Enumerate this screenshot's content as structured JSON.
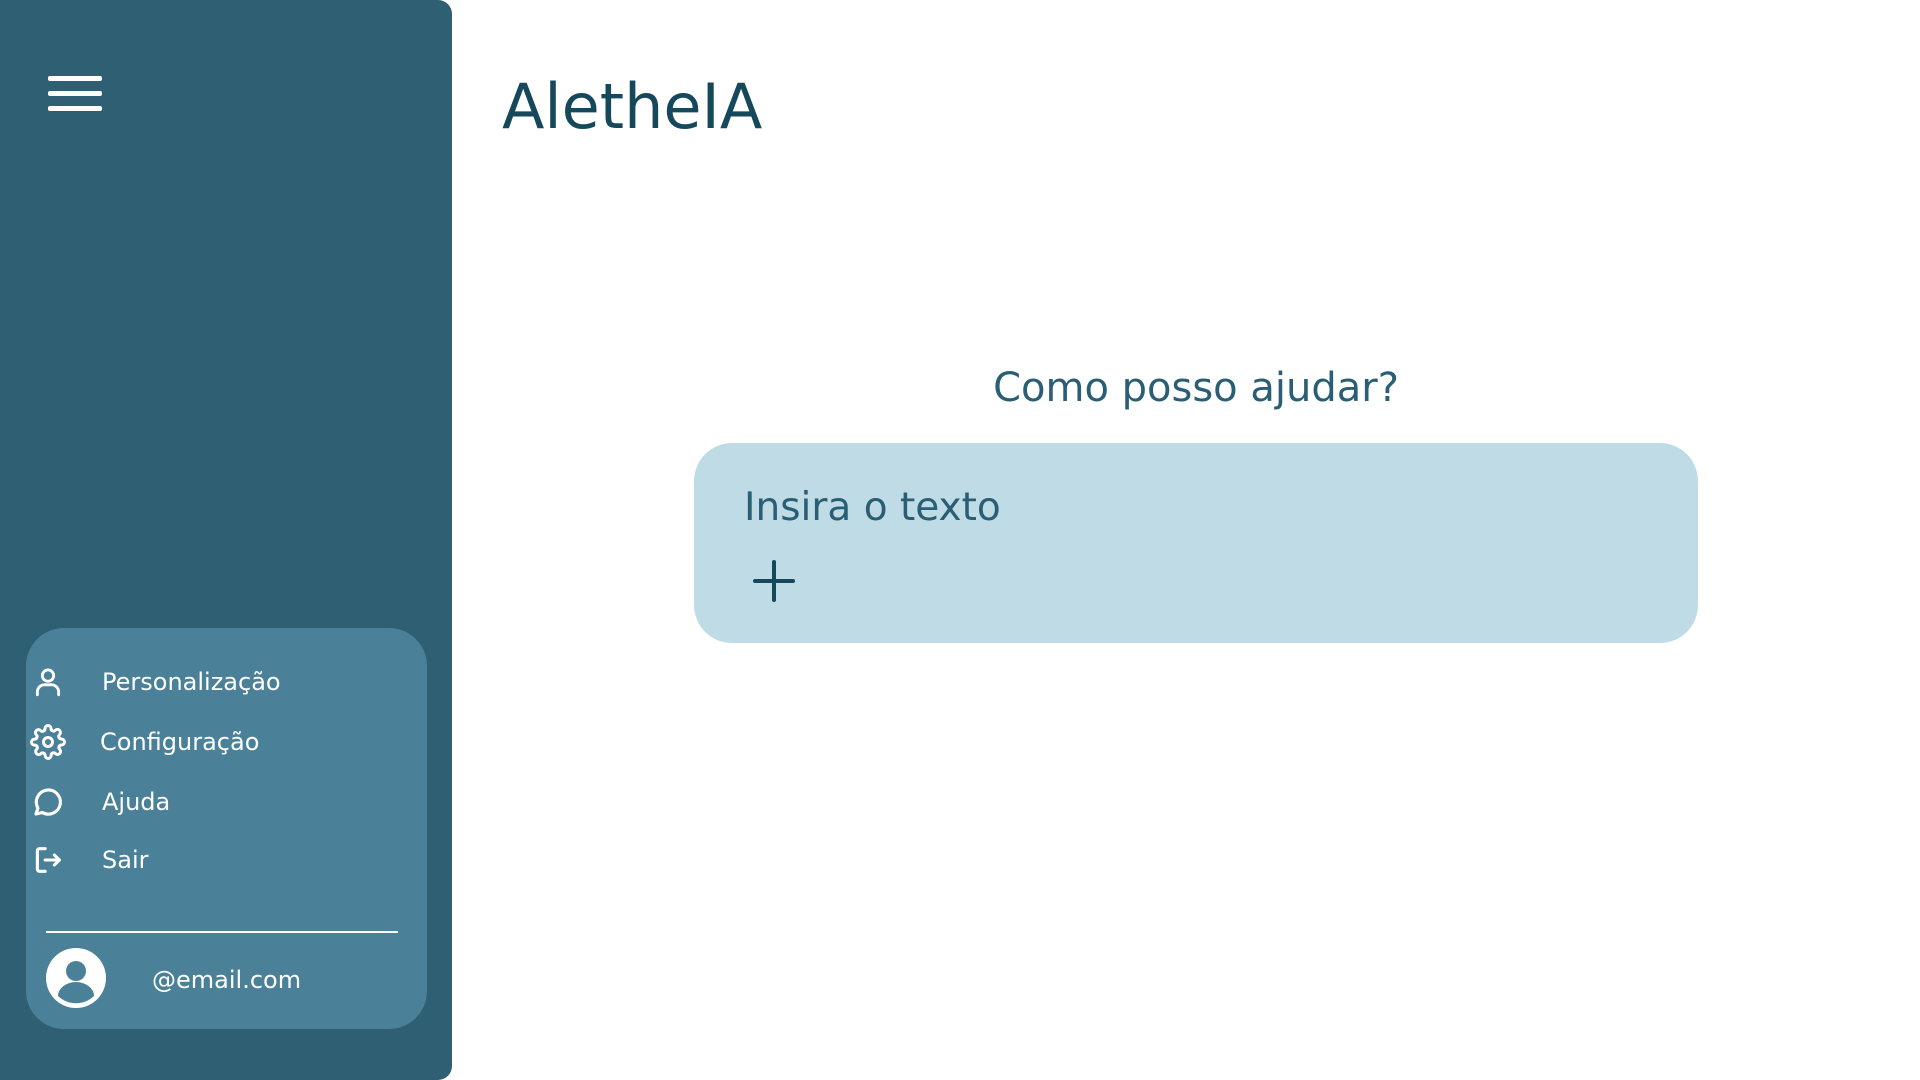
{
  "app": {
    "title": "AletheIA"
  },
  "sidebar": {
    "menu_icon": "hamburger-menu-icon",
    "items": [
      {
        "label": "Personalização",
        "icon": "user-icon"
      },
      {
        "label": "Configuração",
        "icon": "gear-icon"
      },
      {
        "label": "Ajuda",
        "icon": "chat-bubble-icon"
      },
      {
        "label": "Sair",
        "icon": "logout-icon"
      }
    ],
    "user": {
      "email": "@email.com",
      "icon": "user-avatar-icon"
    }
  },
  "main": {
    "prompt": "Como posso ajudar?",
    "input": {
      "placeholder": "Insira o texto",
      "value": ""
    },
    "add_icon": "plus-icon"
  },
  "colors": {
    "sidebar_bg": "#2e5f72",
    "panel_bg": "#4a8199",
    "input_bg": "#bfdce6",
    "title_text": "#16485c",
    "accent_text": "#2a5e74"
  }
}
